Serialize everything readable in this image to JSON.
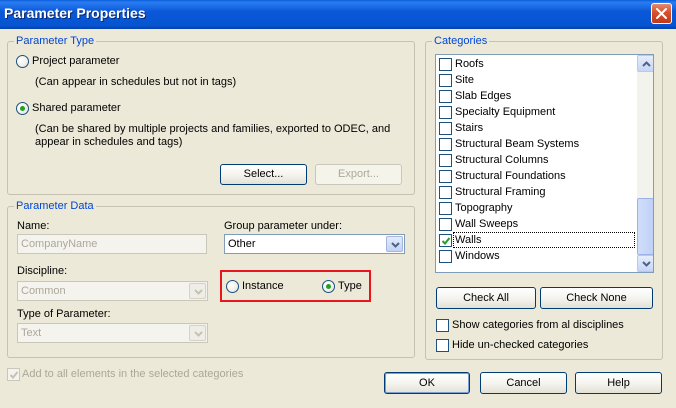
{
  "window": {
    "title": "Parameter Properties"
  },
  "parameter_type": {
    "legend": "Parameter Type",
    "project_label": "Project parameter",
    "project_desc": "(Can appear in schedules but not in tags)",
    "shared_label": "Shared parameter",
    "shared_desc_1": "(Can be shared by multiple projects and families, exported to ODEC, and",
    "shared_desc_2": "appear in schedules and tags)",
    "selected": "shared",
    "select_button": "Select...",
    "export_button": "Export..."
  },
  "parameter_data": {
    "legend": "Parameter Data",
    "name_label": "Name:",
    "name_value": "CompanyName",
    "group_label": "Group parameter under:",
    "group_value": "Other",
    "discipline_label": "Discipline:",
    "discipline_value": "Common",
    "type_label": "Type of Parameter:",
    "type_value": "Text",
    "instance_label": "Instance",
    "type_radio_label": "Type",
    "selected_scope": "type"
  },
  "categories": {
    "legend": "Categories",
    "items": [
      {
        "label": "Roofs",
        "checked": false
      },
      {
        "label": "Site",
        "checked": false
      },
      {
        "label": "Slab Edges",
        "checked": false
      },
      {
        "label": "Specialty Equipment",
        "checked": false
      },
      {
        "label": "Stairs",
        "checked": false
      },
      {
        "label": "Structural Beam Systems",
        "checked": false
      },
      {
        "label": "Structural Columns",
        "checked": false
      },
      {
        "label": "Structural Foundations",
        "checked": false
      },
      {
        "label": "Structural Framing",
        "checked": false
      },
      {
        "label": "Topography",
        "checked": false
      },
      {
        "label": "Wall Sweeps",
        "checked": false
      },
      {
        "label": "Walls",
        "checked": true
      },
      {
        "label": "Windows",
        "checked": false
      }
    ],
    "check_all_button": "Check All",
    "check_none_button": "Check None",
    "show_all_label": "Show categories from al disciplines",
    "hide_unchecked_label": "Hide un-checked categories"
  },
  "footer": {
    "add_all_label": "Add to all elements in the selected categories",
    "ok_button": "OK",
    "cancel_button": "Cancel",
    "help_button": "Help"
  },
  "colors": {
    "legend_blue": "#0046d5",
    "highlight_red": "#e8161c",
    "radio_dot_green": "#21a121",
    "titlebar_blue": "#0554d2"
  }
}
